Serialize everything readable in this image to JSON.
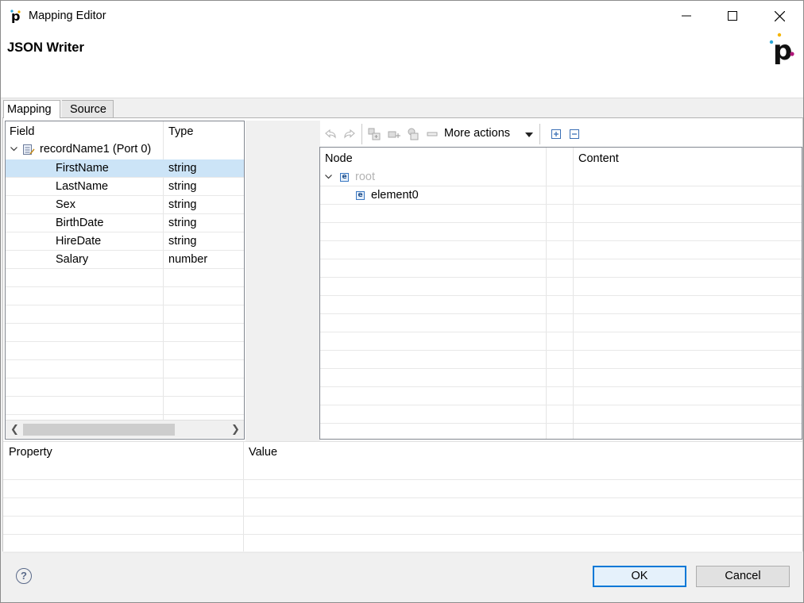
{
  "window": {
    "title": "Mapping Editor"
  },
  "header": {
    "title": "JSON Writer"
  },
  "tabs": [
    {
      "label": "Mapping"
    },
    {
      "label": "Source"
    }
  ],
  "fields_table": {
    "columns": [
      "Field",
      "Type"
    ],
    "root": {
      "label": "recordName1 (Port 0)"
    },
    "rows": [
      {
        "name": "FirstName",
        "type": "string",
        "selected": true
      },
      {
        "name": "LastName",
        "type": "string"
      },
      {
        "name": "Sex",
        "type": "string"
      },
      {
        "name": "BirthDate",
        "type": "string"
      },
      {
        "name": "HireDate",
        "type": "string"
      },
      {
        "name": "Salary",
        "type": "number"
      }
    ]
  },
  "toolbar": {
    "more_actions_label": "More actions"
  },
  "node_table": {
    "columns": [
      "Node",
      "",
      "Content"
    ],
    "nodes": [
      {
        "label": "root",
        "disabled": true
      },
      {
        "label": "element0"
      }
    ]
  },
  "property_table": {
    "columns": [
      "Property",
      "Value"
    ]
  },
  "footer": {
    "help_label": "?",
    "ok_label": "OK",
    "cancel_label": "Cancel"
  }
}
